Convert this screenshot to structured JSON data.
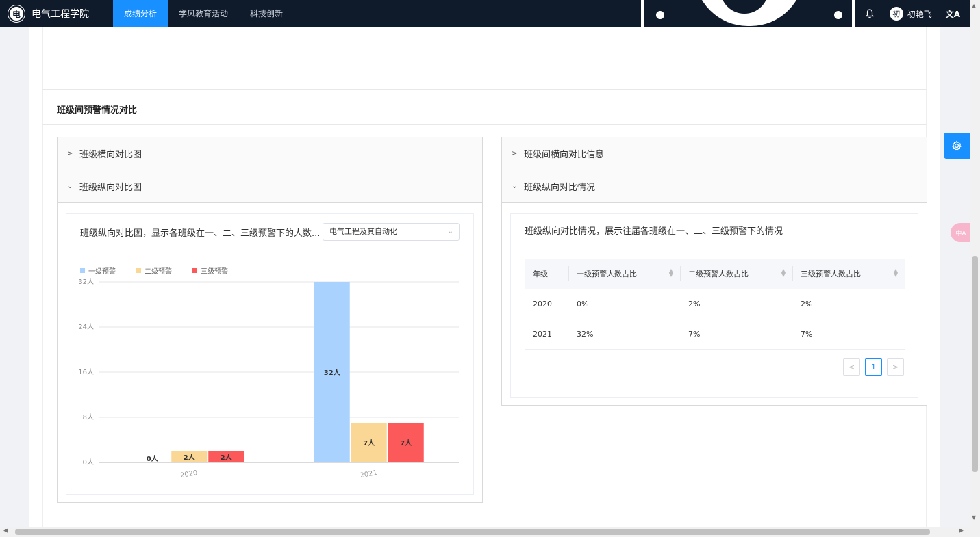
{
  "header": {
    "brand_logo": "电",
    "brand_name": "电气工程学院",
    "nav": [
      {
        "label": "成绩分析",
        "active": true
      },
      {
        "label": "学风教育活动",
        "active": false
      },
      {
        "label": "科技创新",
        "active": false
      }
    ],
    "avatar_glyph": "初",
    "username": "初艳飞",
    "language_glyph": "文A"
  },
  "section": {
    "title": "班级间预警情况对比"
  },
  "left_panel": {
    "collapsed_title": "班级横向对比图",
    "expanded_title": "班级纵向对比图",
    "card_title": "班级纵向对比图，显示各班级在一、二、三级预警下的人数...",
    "select_value": "电气工程及其自动化"
  },
  "right_panel": {
    "collapsed_title": "班级间横向对比信息",
    "expanded_title": "班级纵向对比情况",
    "card_title": "班级纵向对比情况，展示往届各班级在一、二、三级预警下的情况",
    "table": {
      "headers": [
        "年级",
        "一级预警人数占比",
        "二级预警人数占比",
        "三级预警人数占比"
      ],
      "rows": [
        [
          "2020",
          "0%",
          "2%",
          "2%"
        ],
        [
          "2021",
          "32%",
          "7%",
          "7%"
        ]
      ]
    },
    "pager": {
      "prev": "<",
      "current": "1",
      "next": ">"
    }
  },
  "side_widgets": {
    "translate_label": "中A"
  },
  "colors": {
    "nav_bg": "#0f1a2b",
    "accent": "#1890ff",
    "level1": "#aad2ff",
    "level2": "#fbd796",
    "level3": "#fc5a5a"
  },
  "chart_data": {
    "type": "bar",
    "categories": [
      "2020",
      "2021"
    ],
    "series": [
      {
        "name": "一级预警",
        "values": [
          0,
          32
        ],
        "color": "#aad2ff"
      },
      {
        "name": "二级预警",
        "values": [
          2,
          7
        ],
        "color": "#fbd796"
      },
      {
        "name": "三级预警",
        "values": [
          2,
          7
        ],
        "color": "#fc5a5a"
      }
    ],
    "y_ticks": [
      "0人",
      "8人",
      "16人",
      "24人",
      "32人"
    ],
    "value_suffix": "人",
    "ylim": [
      0,
      32
    ],
    "legend_position": "top-left",
    "grid": true
  }
}
